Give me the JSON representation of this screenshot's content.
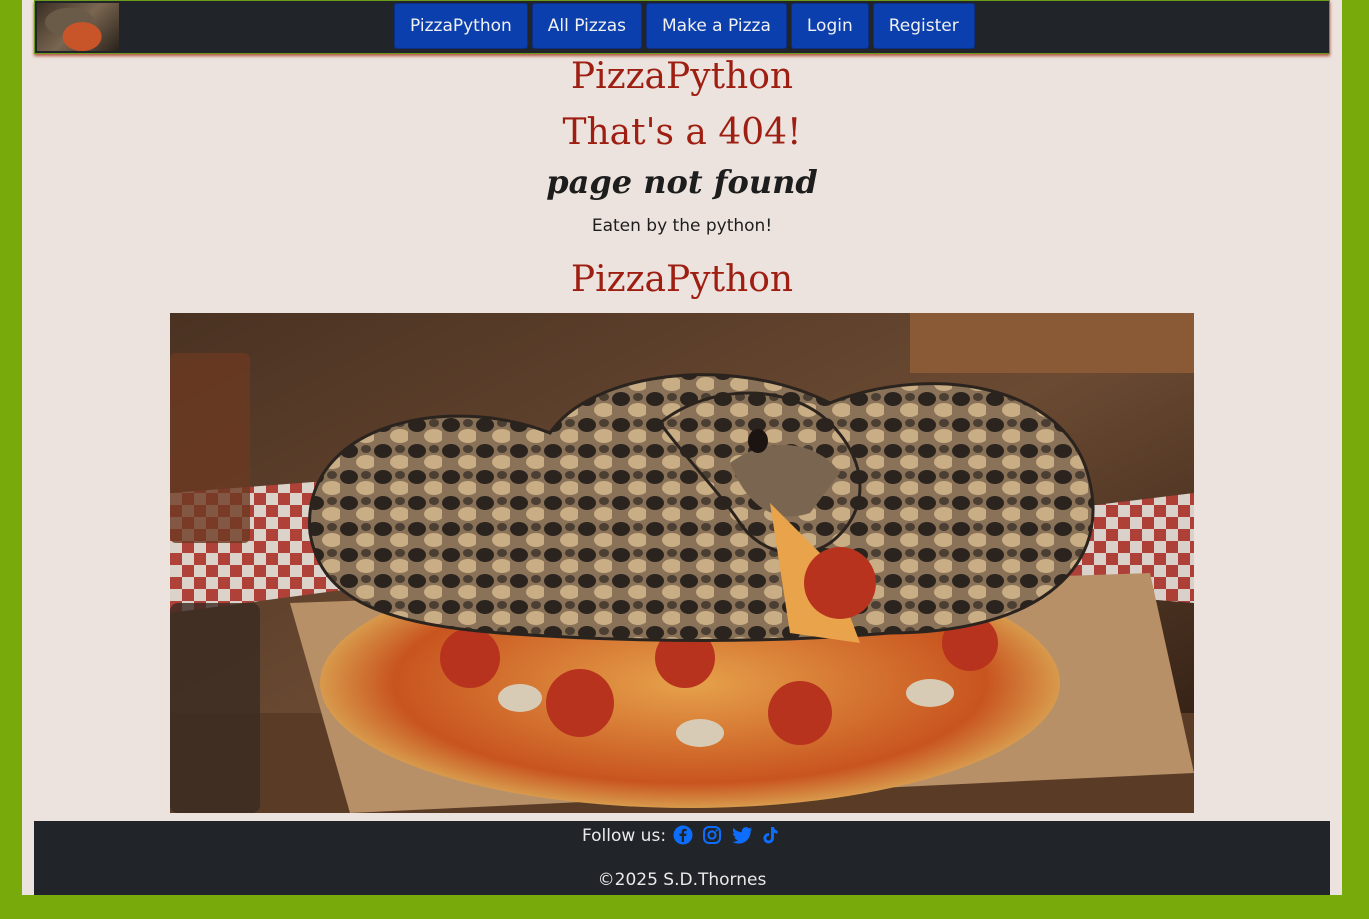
{
  "navbar": {
    "logo_alt": "PizzaPython logo",
    "items": [
      {
        "label": "PizzaPython"
      },
      {
        "label": "All Pizzas"
      },
      {
        "label": "Make a Pizza"
      },
      {
        "label": "Login"
      },
      {
        "label": "Register"
      }
    ]
  },
  "main": {
    "site_title": "PizzaPython",
    "error_title": "That's a 404!",
    "error_subtitle": "page not found",
    "message": "Eaten by the python!",
    "site_title_2": "PizzaPython"
  },
  "footer": {
    "follow_label": "Follow us:",
    "social_icons": [
      "facebook-icon",
      "instagram-icon",
      "twitter-icon",
      "tiktok-icon"
    ],
    "copyright": "©2025 S.D.Thornes"
  },
  "colors": {
    "outer_background": "#77aa0a",
    "page_background": "#ece3de",
    "navbar_background": "#212529",
    "nav_button": "#0b3fae",
    "heading_red": "#9e1f12",
    "social_icon_blue": "#0d6efd"
  }
}
